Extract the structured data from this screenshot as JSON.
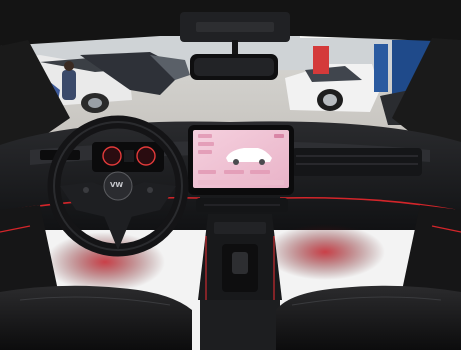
{
  "scene": {
    "subject": "car-interior",
    "colors": {
      "frame": "#141414",
      "dash": "#1b1c1f",
      "screen": "#f2c9d8",
      "ambient_red": "#d4252a",
      "showroom": "#e8e8e6"
    }
  },
  "steering_wheel": {
    "logo": "VW"
  },
  "infotainment": {
    "tiles": [
      "",
      "",
      "",
      "",
      "",
      "",
      ""
    ]
  }
}
